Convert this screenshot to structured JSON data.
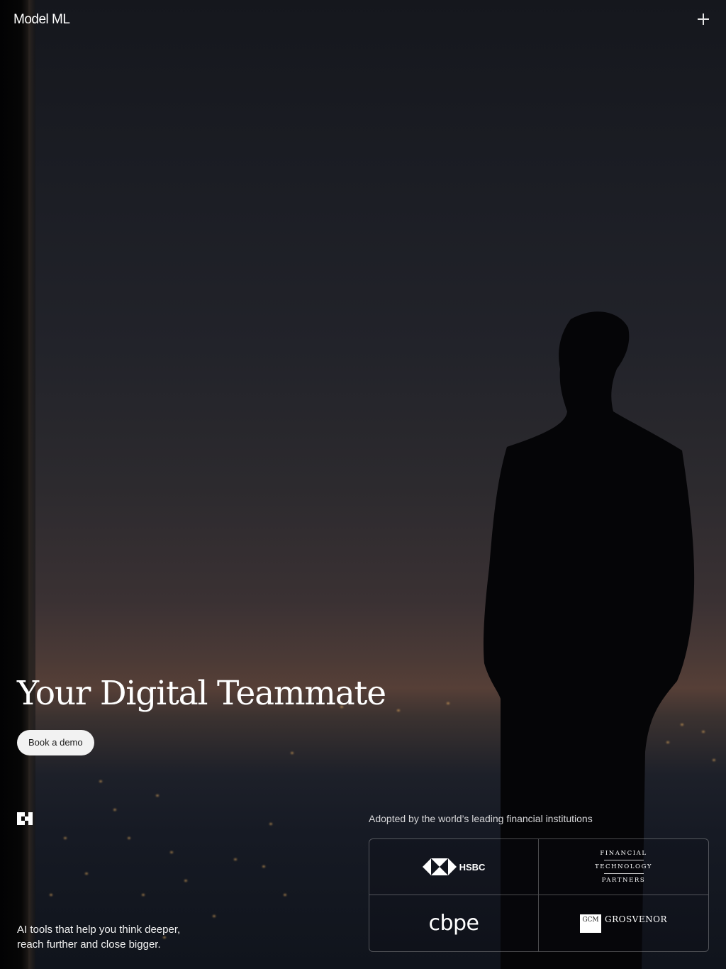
{
  "header": {
    "brand": "Model ML",
    "menu_icon": "plus-icon"
  },
  "hero": {
    "headline": "Your Digital Teammate",
    "cta_label": "Book a demo",
    "mark_icon": "model-ml-mark-icon",
    "tagline_line1": "AI tools that help you think deeper,",
    "tagline_line2": "reach further and close bigger."
  },
  "logos": {
    "heading": "Adopted by the world’s leading financial institutions",
    "items": [
      {
        "name": "HSBC",
        "text": "HSBC",
        "icon": "hsbc-hexagon-icon"
      },
      {
        "name": "Financial Technology Partners",
        "line1": "FINANCIAL",
        "line2": "TECHNOLOGY",
        "line3": "PARTNERS"
      },
      {
        "name": "cbpe",
        "text": "cbpe"
      },
      {
        "name": "GCM Grosvenor",
        "box": "GCM",
        "text": "GROSVENOR"
      }
    ]
  },
  "colors": {
    "background_top": "#15171d",
    "horizon_glow": "#563f37",
    "text": "#ffffff",
    "button_bg": "#f2f2f2",
    "button_text": "#1a1a1a"
  }
}
